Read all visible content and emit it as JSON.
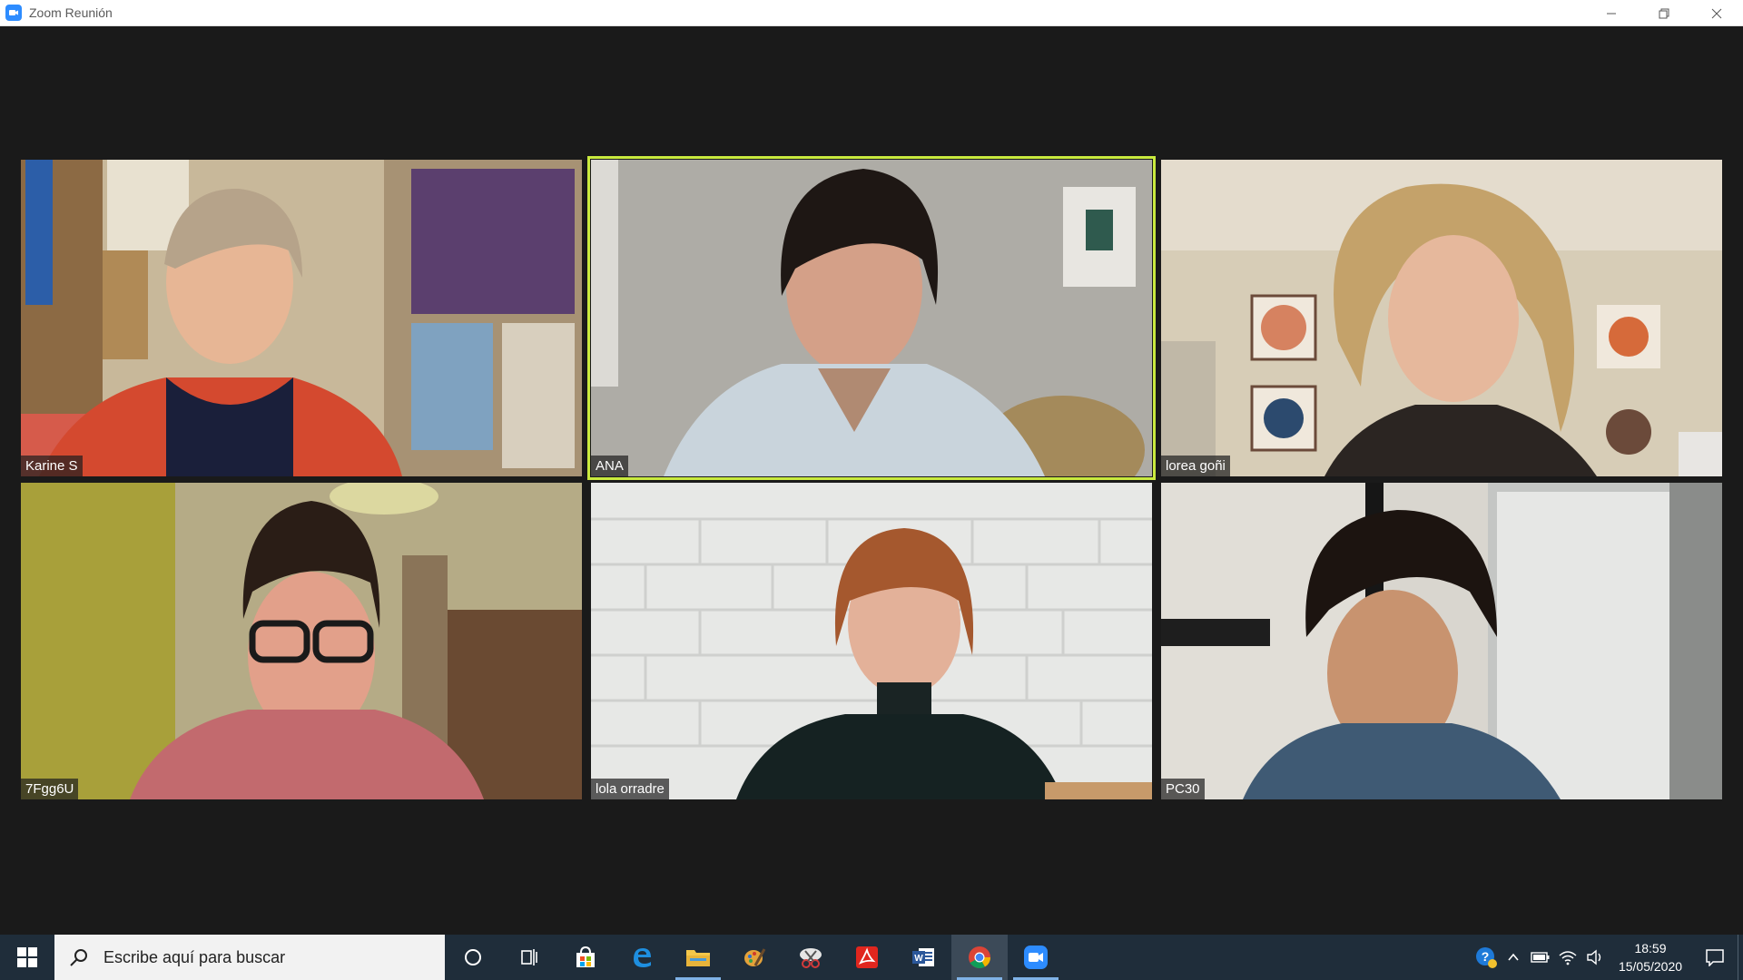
{
  "window": {
    "title": "Zoom Reunión"
  },
  "participants": [
    {
      "name": "Karine S",
      "active": false
    },
    {
      "name": "ANA",
      "active": true
    },
    {
      "name": "lorea goñi",
      "active": false
    },
    {
      "name": "7Fgg6U",
      "active": false
    },
    {
      "name": "lola orradre",
      "active": false
    },
    {
      "name": "PC30",
      "active": false
    }
  ],
  "taskbar": {
    "search_placeholder": "Escribe aquí para buscar",
    "apps": [
      "cortana-icon",
      "task-view-icon",
      "store-icon",
      "edge-icon",
      "file-explorer-icon",
      "paint-icon",
      "snipping-icon",
      "acrobat-icon",
      "word-icon",
      "chrome-icon",
      "zoom-icon"
    ],
    "time": "18:59",
    "date": "15/05/2020"
  },
  "colors": {
    "active_speaker_border": "#c9ea3e",
    "taskbar_bg": "#1f2d3a",
    "meeting_bg": "#1a1a1a",
    "zoom_blue": "#2d8cff"
  }
}
